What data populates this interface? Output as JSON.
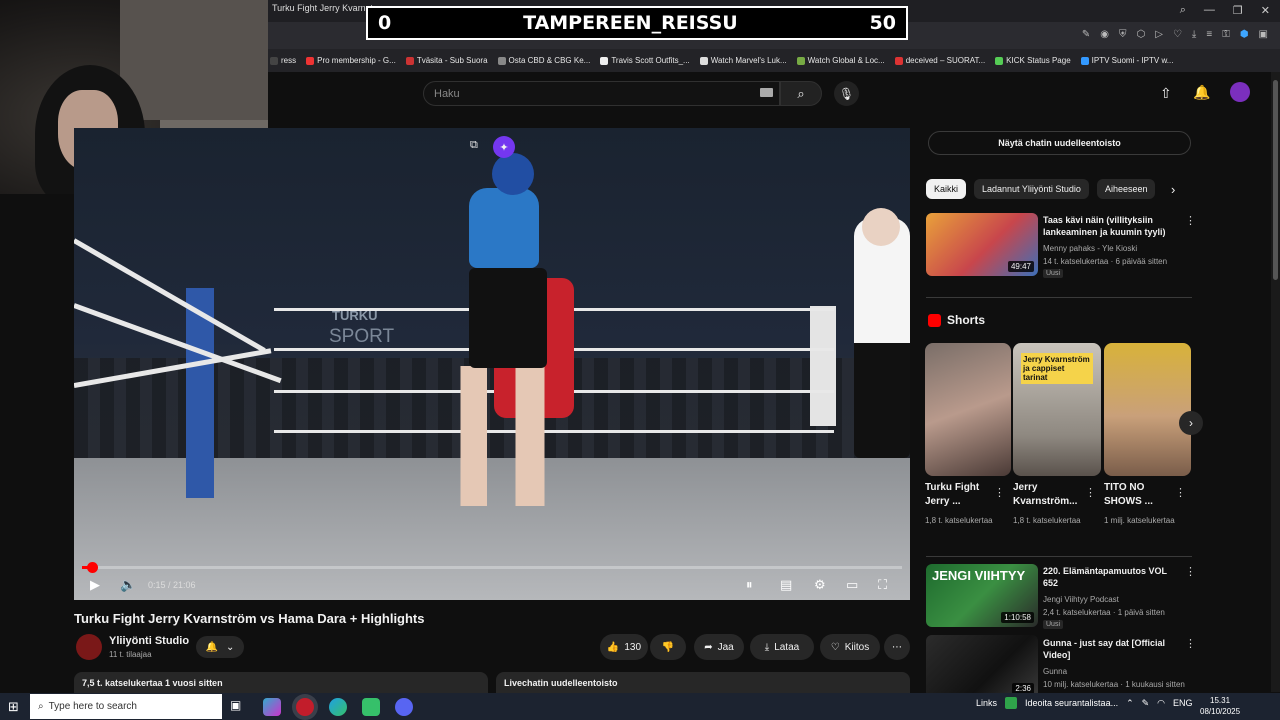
{
  "browser": {
    "tab_title": "Turku Fight Jerry Kvarnstr...",
    "bookmarks": [
      {
        "label": "ress",
        "color": "#444"
      },
      {
        "label": "Pro membership - G...",
        "color": "#e33"
      },
      {
        "label": "Tväsita - Sub Suora",
        "color": "#c33"
      },
      {
        "label": "Osta CBD & CBG Ke...",
        "color": "#888"
      },
      {
        "label": "Travis Scott Outfits_...",
        "color": "#eee"
      },
      {
        "label": "Watch Marvel's Luk...",
        "color": "#ddd"
      },
      {
        "label": "Watch Global & Loc...",
        "color": "#7a4"
      },
      {
        "label": "deceived – SUORAT...",
        "color": "#d33"
      },
      {
        "label": "KICK Status Page",
        "color": "#5c5"
      },
      {
        "label": "IPTV Suomi - IPTV w...",
        "color": "#39f"
      }
    ]
  },
  "scoreboard": {
    "left": "0",
    "center": "TAMPEREEN_REISSU",
    "right": "50"
  },
  "header": {
    "search_placeholder": "Haku"
  },
  "player": {
    "time": "0:15 / 21:06",
    "progress": 0.012,
    "overlay_turku": "TURKU",
    "overlay_sport": "SPORT"
  },
  "video": {
    "title": "Turku Fight Jerry Kvarnström vs Hama Dara + Highlights",
    "channel": "Yliiyönti Studio",
    "subscribers": "11 t. tilaajaa",
    "likes": "130",
    "share": "Jaa",
    "download": "Lataa",
    "thanks": "Kiitos",
    "views_line": "7,5 t. katselukertaa  1 vuosi sitten",
    "chat_replay_short": "Livechatin uudelleentoisto"
  },
  "sidebar": {
    "chat_replay": "Näytä chatin uudelleentoisto",
    "chips": [
      "Kaikki",
      "Ladannut Yliiyönti Studio",
      "Aiheeseen"
    ],
    "recommended_top": {
      "title": "Taas kävi näin (villityksiin lankeaminen ja kuumin tyyli)",
      "channel": "Menny pahaks - Yle Kioski",
      "meta": "14 t. katselukertaa · 6 päivää sitten",
      "badge": "Uusi",
      "duration": "49:47"
    },
    "shorts_label": "Shorts",
    "shorts": [
      {
        "title": "Turku Fight Jerry ...",
        "views": "1,8 t. katselukertaa",
        "overlay": ""
      },
      {
        "title": "Jerry Kvarnström...",
        "views": "1,8 t. katselukertaa",
        "overlay": "Jerry Kvarnström ja cappiset tarinat"
      },
      {
        "title": "TITO NO SHOWS ...",
        "views": "1 milj. katselukertaa",
        "overlay": ""
      }
    ],
    "recommended": [
      {
        "title": "220. Elämäntapamuutos VOL 652",
        "channel": "Jengi Viihtyy Podcast",
        "meta": "2,4 t. katselukertaa · 1 päivä sitten",
        "badge": "Uusi",
        "duration": "1:10:58",
        "thumb_text": "JENGI VIIHTYY"
      },
      {
        "title": "Gunna - just say dat [Official Video]",
        "channel": "Gunna",
        "meta": "10 milj. katselukertaa · 1 kuukausi sitten",
        "badge": "",
        "duration": "2:36",
        "thumb_text": ""
      }
    ]
  },
  "taskbar": {
    "search_placeholder": "Type here to search",
    "links": "Links",
    "idea": "Ideoita seurantalistaa...",
    "lang": "ENG",
    "time": "15.31",
    "date": "08/10/2025"
  },
  "colors": {
    "accent": "#ff0000",
    "purple": "#7437f0",
    "bg": "#0f0f0f"
  }
}
